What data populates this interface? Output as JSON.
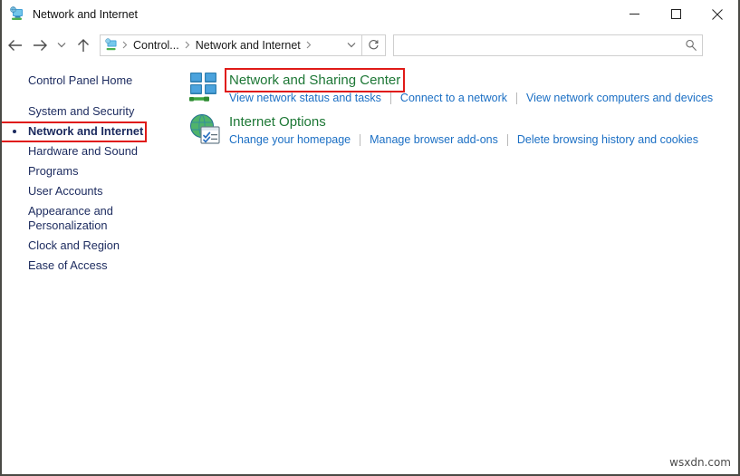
{
  "window": {
    "title": "Network and Internet",
    "title_icon": "network-computer-icon",
    "minimize_label": "Minimize",
    "maximize_label": "Maximize",
    "close_label": "Close"
  },
  "nav": {
    "back_label": "Back",
    "forward_label": "Forward",
    "recent_label": "Recent locations",
    "up_label": "Up one level",
    "breadcrumb_icon": "control-panel-icon",
    "breadcrumbs": [
      {
        "label": "Control..."
      },
      {
        "label": "Network and Internet"
      }
    ],
    "dropdown_label": "Previous locations",
    "refresh_label": "Refresh"
  },
  "search": {
    "value": "",
    "placeholder": "",
    "icon": "search-icon"
  },
  "sidebar": {
    "items": [
      {
        "label": "Control Panel Home",
        "selected": false
      },
      {
        "label": "System and Security",
        "selected": false
      },
      {
        "label": "Network and Internet",
        "selected": true
      },
      {
        "label": "Hardware and Sound",
        "selected": false
      },
      {
        "label": "Programs",
        "selected": false
      },
      {
        "label": "User Accounts",
        "selected": false
      },
      {
        "label": "Appearance and Personalization",
        "selected": false
      },
      {
        "label": "Clock and Region",
        "selected": false
      },
      {
        "label": "Ease of Access",
        "selected": false
      }
    ]
  },
  "main": {
    "categories": [
      {
        "icon": "network-sharing-center-icon",
        "title": "Network and Sharing Center",
        "highlighted": true,
        "links": [
          "View network status and tasks",
          "Connect to a network",
          "View network computers and devices"
        ]
      },
      {
        "icon": "internet-options-icon",
        "title": "Internet Options",
        "highlighted": false,
        "links": [
          "Change your homepage",
          "Manage browser add-ons",
          "Delete browsing history and cookies"
        ]
      }
    ]
  },
  "watermark": {
    "text": "wsxdn.com"
  },
  "colors": {
    "heading_green": "#1d7735",
    "link_blue": "#1b6fc4",
    "sidebar_navy": "#1b2a5e",
    "highlight_red": "#e01b18"
  }
}
